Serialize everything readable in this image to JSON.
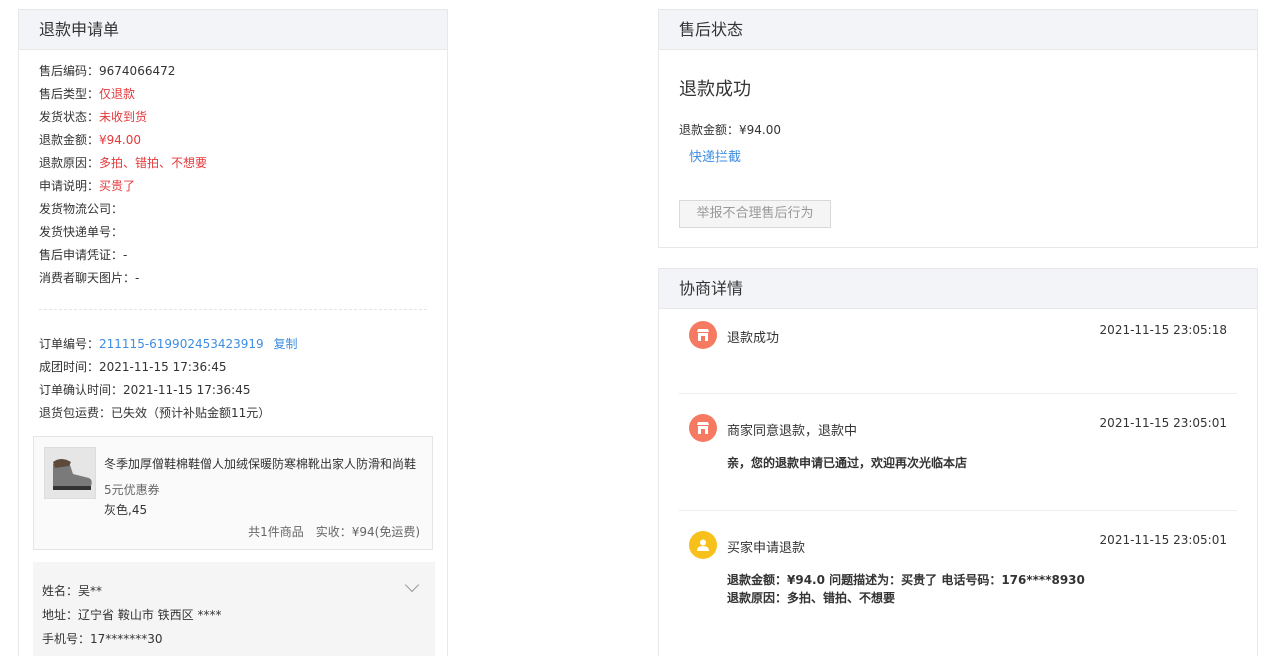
{
  "refund_form": {
    "title": "退款申请单",
    "fields": [
      {
        "label": "售后编码：",
        "value": "9674066472",
        "tone": "normal"
      },
      {
        "label": "售后类型：",
        "value": "仅退款",
        "tone": "red"
      },
      {
        "label": "发货状态：",
        "value": "未收到货",
        "tone": "red"
      },
      {
        "label": "退款金额：",
        "value": "¥94.00",
        "tone": "red"
      },
      {
        "label": "退款原因：",
        "value": "多拍、错拍、不想要",
        "tone": "red"
      },
      {
        "label": "申请说明：",
        "value": "买贵了",
        "tone": "red"
      },
      {
        "label": "发货物流公司：",
        "value": "",
        "tone": "normal"
      },
      {
        "label": "发货快递单号：",
        "value": "",
        "tone": "normal"
      },
      {
        "label": "售后申请凭证：",
        "value": "-",
        "tone": "normal"
      },
      {
        "label": "消费者聊天图片：",
        "value": "-",
        "tone": "normal"
      }
    ],
    "order": {
      "number_label": "订单编号：",
      "number": "211115-619902453423919",
      "copy_label": "复制",
      "group_time_label": "成团时间：",
      "group_time": "2021-11-15 17:36:45",
      "confirm_time_label": "订单确认时间：",
      "confirm_time": "2021-11-15 17:36:45",
      "return_shipping_label": "退货包运费：",
      "return_shipping": "已失效（预计补贴金额11元）"
    },
    "product": {
      "name": "冬季加厚僧鞋棉鞋僧人加绒保暖防寒棉靴出家人防滑和尚鞋",
      "coupon": "5元优惠券",
      "spec": "灰色,45",
      "total": "共1件商品　实收：¥94(免运费)"
    },
    "address": {
      "name_label": "姓名：",
      "name": "吴**",
      "addr_label": "地址：",
      "addr": "辽宁省 鞍山市 铁西区 ****",
      "phone_label": "手机号：",
      "phone": "17*******30"
    }
  },
  "after_sale_status": {
    "title": "售后状态",
    "status": "退款成功",
    "refund_amount": "退款金额：¥94.00",
    "intercept_link": "快递拦截",
    "report_button": "举报不合理售后行为"
  },
  "negotiation": {
    "title": "协商详情",
    "events": [
      {
        "title": "退款成功",
        "time": "2021-11-15 23:05:18",
        "desc": [],
        "icon": "store-icon",
        "color": "#f57a61"
      },
      {
        "title": "商家同意退款，退款中",
        "time": "2021-11-15 23:05:01",
        "desc": [
          "亲，您的退款申请已通过，欢迎再次光临本店"
        ],
        "icon": "store-icon",
        "color": "#f57a61"
      },
      {
        "title": "买家申请退款",
        "time": "2021-11-15 23:05:01",
        "desc": [
          "退款金额：¥94.0 问题描述为：买贵了 电话号码：176****8930",
          "退款原因：多拍、错拍、不想要"
        ],
        "icon": "user-icon",
        "color": "#f8c01b"
      }
    ]
  }
}
